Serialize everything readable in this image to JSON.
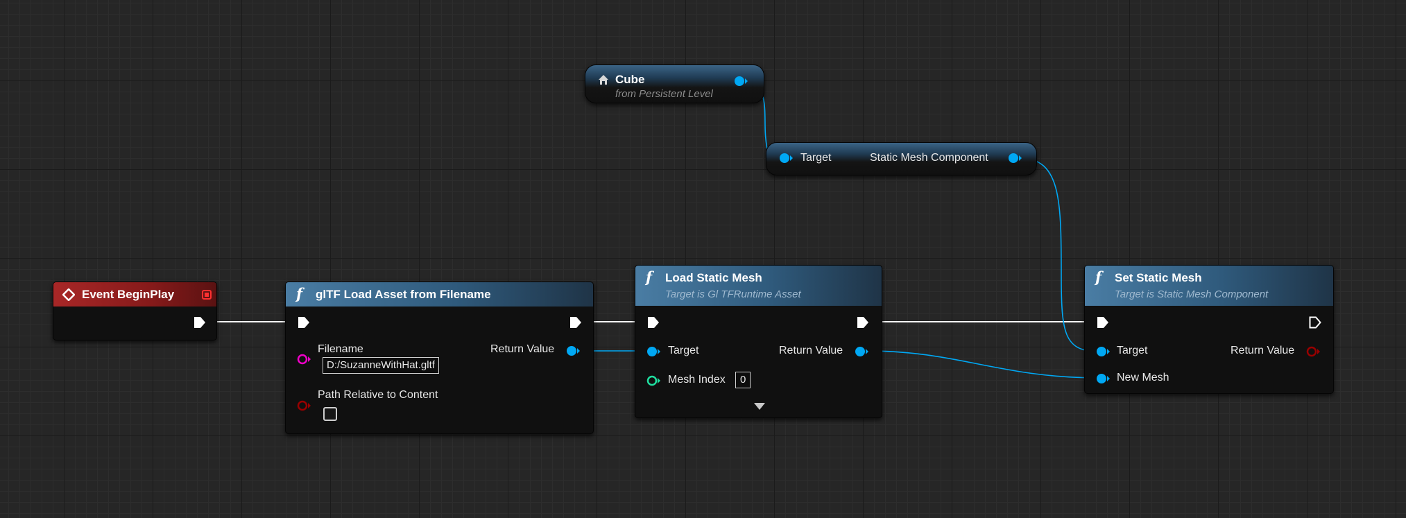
{
  "nodes": {
    "cube": {
      "title": "Cube",
      "subtitle": "from Persistent Level"
    },
    "get_component": {
      "target_label": "Target",
      "output_label": "Static Mesh Component"
    },
    "event_begin_play": {
      "title": "Event BeginPlay"
    },
    "gltf_load": {
      "title": "glTF Load Asset from Filename",
      "filename_label": "Filename",
      "filename_value": "D:/SuzanneWithHat.gltf",
      "path_relative_label": "Path Relative to Content",
      "path_relative_checked": false,
      "return_label": "Return Value"
    },
    "load_static_mesh": {
      "title": "Load Static Mesh",
      "subtitle": "Target is Gl TFRuntime Asset",
      "target_label": "Target",
      "return_label": "Return Value",
      "mesh_index_label": "Mesh Index",
      "mesh_index_value": "0"
    },
    "set_static_mesh": {
      "title": "Set Static Mesh",
      "subtitle": "Target is Static Mesh Component",
      "target_label": "Target",
      "return_label": "Return Value",
      "new_mesh_label": "New Mesh"
    }
  },
  "colors": {
    "exec": "#ffffff",
    "object": "#00a8f4",
    "string": "#f000c8",
    "bool": "#990000",
    "int": "#1fe0a0"
  },
  "icons": {
    "function": "function-icon",
    "event": "event-diamond-icon",
    "actor": "actor-house-icon"
  }
}
